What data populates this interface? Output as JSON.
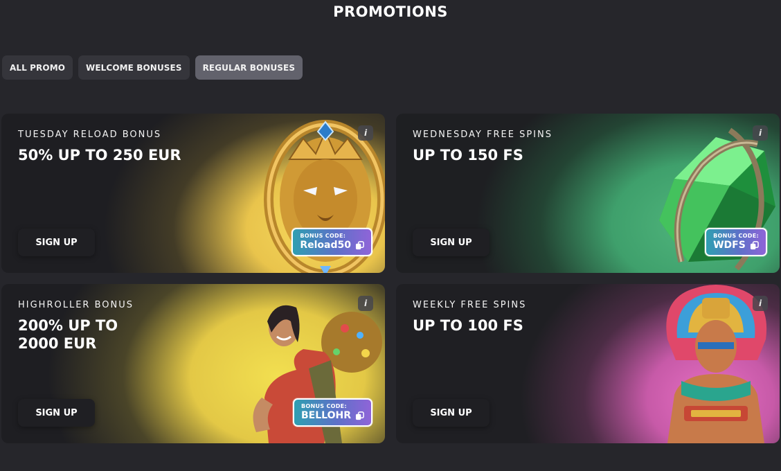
{
  "page": {
    "title": "PROMOTIONS"
  },
  "filters": [
    {
      "label": "ALL PROMO",
      "active": false
    },
    {
      "label": "WELCOME BONUSES",
      "active": false
    },
    {
      "label": "REGULAR BONUSES",
      "active": true
    }
  ],
  "cards": [
    {
      "label": "TUESDAY RELOAD BONUS",
      "title": "50% UP TO 250 EUR",
      "button": "SIGN UP",
      "info": "i",
      "bonus_label": "BONUS CODE:",
      "bonus_code": "Reload50",
      "art_icon": "lion-crest-icon"
    },
    {
      "label": "WEDNESDAY FREE SPINS",
      "title": "UP TO 150 FS",
      "button": "SIGN UP",
      "info": "i",
      "bonus_label": "BONUS CODE:",
      "bonus_code": "WDFS",
      "art_icon": "emerald-gem-icon"
    },
    {
      "label": "HIGHROLLER BONUS",
      "title_line1": "200% UP TO",
      "title_line2": "2000 EUR",
      "button": "SIGN UP",
      "info": "i",
      "bonus_label": "BONUS CODE:",
      "bonus_code": "BELLOHR",
      "art_icon": "adventurer-woman-icon"
    },
    {
      "label": "WEEKLY FREE SPINS",
      "title": "UP TO 100 FS",
      "button": "SIGN UP",
      "info": "i",
      "art_icon": "aztec-warrior-icon"
    }
  ],
  "colors": {
    "background": "#26262b",
    "filter_bg": "#35353b",
    "filter_active_bg": "#62626c",
    "yellow": "#f6d85d",
    "green": "#4fb57c",
    "pink": "#e76fc3",
    "bonus_gradient_start": "#2f9fb1",
    "bonus_gradient_end": "#8f64d8"
  }
}
